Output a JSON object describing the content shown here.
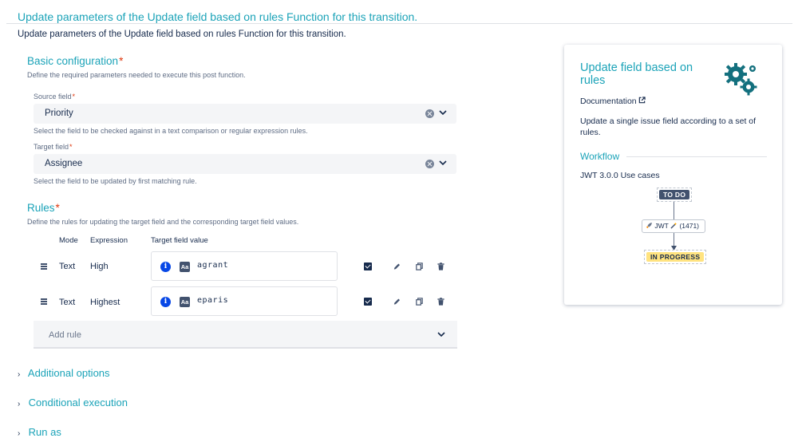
{
  "header": {
    "title": "Update parameters of the Update field based on rules Function for this transition.",
    "description": "Update parameters of the Update field based on rules Function for this transition."
  },
  "basic_configuration": {
    "title": "Basic configuration",
    "required_mark": "*",
    "description": "Define the required parameters needed to execute this post function.",
    "source_field": {
      "label": "Source field",
      "value": "Priority",
      "help": "Select the field to be checked against in a text comparison or regular expression rules."
    },
    "target_field": {
      "label": "Target field",
      "value": "Assignee",
      "help": "Select the field to be updated by first matching rule."
    }
  },
  "rules": {
    "title": "Rules",
    "required_mark": "*",
    "description": "Define the rules for updating the target field and the corresponding target field values.",
    "columns": [
      "Mode",
      "Expression",
      "Target field value"
    ],
    "rows": [
      {
        "mode": "Text",
        "expression": "High",
        "value_type": "Aa",
        "value": "agrant",
        "checked": true
      },
      {
        "mode": "Text",
        "expression": "Highest",
        "value_type": "Aa",
        "value": "eparis",
        "checked": true
      }
    ],
    "add_rule_label": "Add rule"
  },
  "sections": {
    "additional_options": "Additional options",
    "conditional_execution": "Conditional execution",
    "run_as": "Run as"
  },
  "side_panel": {
    "title": "Update field based on rules",
    "documentation_label": "Documentation",
    "description": "Update a single issue field according to a set of rules.",
    "workflow_title": "Workflow",
    "use_cases": "JWT 3.0.0 Use cases",
    "workflow": {
      "from_status": "TO DO",
      "transition": "JWT",
      "transition_id": "(1471)",
      "to_status": "IN PROGRESS"
    }
  },
  "colors": {
    "accent": "#1ba3b8",
    "required": "#de350b",
    "text": "#172b4d",
    "muted": "#5e6c84",
    "field_bg": "#f4f5f7",
    "todo_lozenge": "#42526e",
    "inprogress_lozenge": "#ffe380"
  },
  "icons": {
    "clear": "clear-circle-icon",
    "dropdown": "chevron-down-icon",
    "drag": "drag-handle-icon",
    "info": "info-icon",
    "text_type": "text-type-icon",
    "checkbox": "checkbox-checked-icon",
    "edit": "pencil-icon",
    "copy": "copy-icon",
    "delete": "trash-icon",
    "external": "external-link-icon",
    "gears": "gears-icon"
  }
}
